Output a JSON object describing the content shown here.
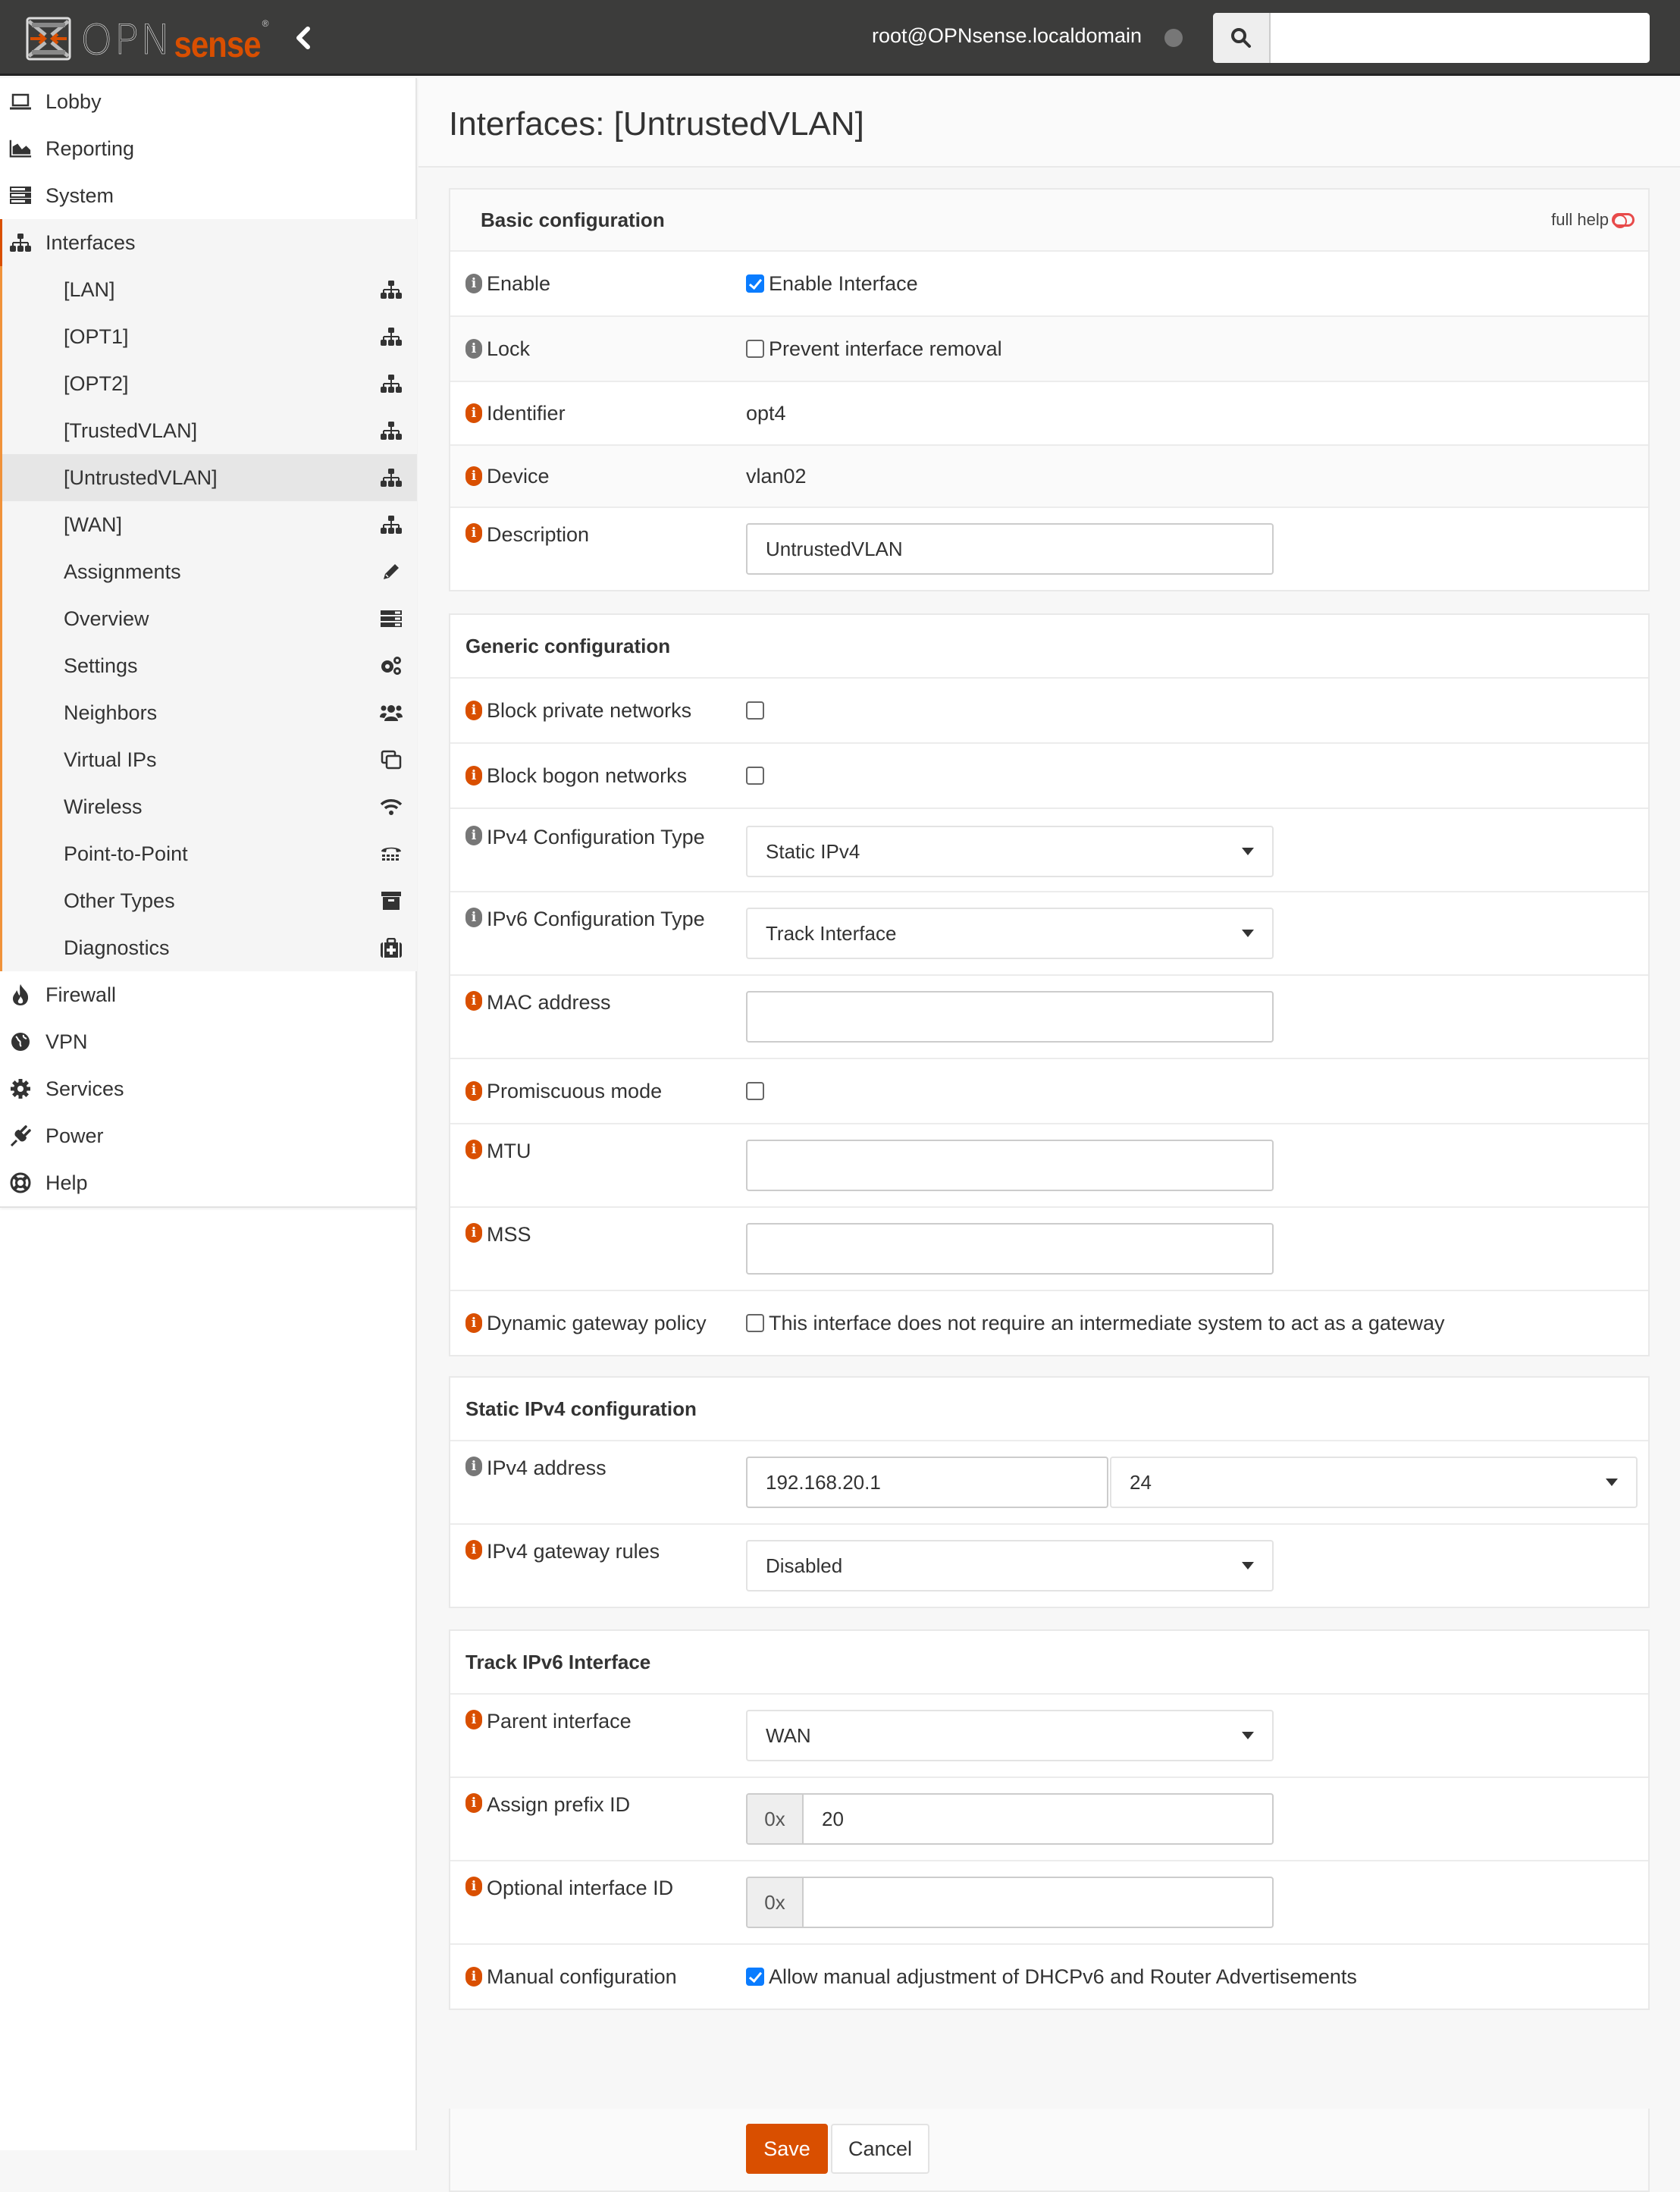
{
  "navbar": {
    "logo_primary": "OPN",
    "logo_secondary": "sense",
    "logo_reg": "®",
    "user": "root@OPNsense.localdomain",
    "search_placeholder": "",
    "search_value": "",
    "brand_color": "#d94f00"
  },
  "sidebar": {
    "top_items": [
      {
        "label": "Lobby",
        "icon": "laptop-icon"
      },
      {
        "label": "Reporting",
        "icon": "area-chart-icon"
      },
      {
        "label": "System",
        "icon": "server-icon"
      }
    ],
    "interfaces": {
      "label": "Interfaces",
      "icon": "sitemap-icon",
      "children": [
        {
          "label": "[LAN]",
          "icon": "sitemap-icon"
        },
        {
          "label": "[OPT1]",
          "icon": "sitemap-icon"
        },
        {
          "label": "[OPT2]",
          "icon": "sitemap-icon"
        },
        {
          "label": "[TrustedVLAN]",
          "icon": "sitemap-icon"
        },
        {
          "label": "[UntrustedVLAN]",
          "icon": "sitemap-icon",
          "active": true
        },
        {
          "label": "[WAN]",
          "icon": "sitemap-icon"
        },
        {
          "label": "Assignments",
          "icon": "pencil-icon"
        },
        {
          "label": "Overview",
          "icon": "tasks-icon"
        },
        {
          "label": "Settings",
          "icon": "cogs-icon"
        },
        {
          "label": "Neighbors",
          "icon": "users-icon"
        },
        {
          "label": "Virtual IPs",
          "icon": "clone-icon"
        },
        {
          "label": "Wireless",
          "icon": "wifi-icon"
        },
        {
          "label": "Point-to-Point",
          "icon": "tty-icon"
        },
        {
          "label": "Other Types",
          "icon": "archive-icon"
        },
        {
          "label": "Diagnostics",
          "icon": "medkit-icon"
        }
      ]
    },
    "bottom_items": [
      {
        "label": "Firewall",
        "icon": "fire-icon"
      },
      {
        "label": "VPN",
        "icon": "globe-icon"
      },
      {
        "label": "Services",
        "icon": "cog-icon"
      },
      {
        "label": "Power",
        "icon": "plug-icon"
      },
      {
        "label": "Help",
        "icon": "life-ring-icon"
      }
    ]
  },
  "page": {
    "title": "Interfaces: [UntrustedVLAN]",
    "full_help_label": "full help"
  },
  "basic": {
    "title": "Basic configuration",
    "enable": {
      "label": "Enable",
      "checkbox_label": "Enable Interface",
      "checked": true
    },
    "lock": {
      "label": "Lock",
      "checkbox_label": "Prevent interface removal",
      "checked": false
    },
    "identifier": {
      "label": "Identifier",
      "value": "opt4"
    },
    "device": {
      "label": "Device",
      "value": "vlan02"
    },
    "description": {
      "label": "Description",
      "value": "UntrustedVLAN"
    }
  },
  "generic": {
    "title": "Generic configuration",
    "block_private": {
      "label": "Block private networks",
      "checked": false
    },
    "block_bogon": {
      "label": "Block bogon networks",
      "checked": false
    },
    "ipv4_type": {
      "label": "IPv4 Configuration Type",
      "value": "Static IPv4"
    },
    "ipv6_type": {
      "label": "IPv6 Configuration Type",
      "value": "Track Interface"
    },
    "mac": {
      "label": "MAC address",
      "value": ""
    },
    "promisc": {
      "label": "Promiscuous mode",
      "checked": false
    },
    "mtu": {
      "label": "MTU",
      "value": ""
    },
    "mss": {
      "label": "MSS",
      "value": ""
    },
    "dyn_gw": {
      "label": "Dynamic gateway policy",
      "checkbox_label": "This interface does not require an intermediate system to act as a gateway",
      "checked": false
    }
  },
  "static_ipv4": {
    "title": "Static IPv4 configuration",
    "address": {
      "label": "IPv4 address",
      "value": "192.168.20.1",
      "subnet": "24"
    },
    "gateway": {
      "label": "IPv4 gateway rules",
      "value": "Disabled"
    }
  },
  "track6": {
    "title": "Track IPv6 Interface",
    "parent": {
      "label": "Parent interface",
      "value": "WAN"
    },
    "prefix_id": {
      "label": "Assign prefix ID",
      "addon": "0x",
      "value": "20"
    },
    "iface_id": {
      "label": "Optional interface ID",
      "addon": "0x",
      "value": ""
    },
    "manual": {
      "label": "Manual configuration",
      "checkbox_label": "Allow manual adjustment of DHCPv6 and Router Advertisements",
      "checked": true
    }
  },
  "actions": {
    "save_label": "Save",
    "cancel_label": "Cancel"
  }
}
